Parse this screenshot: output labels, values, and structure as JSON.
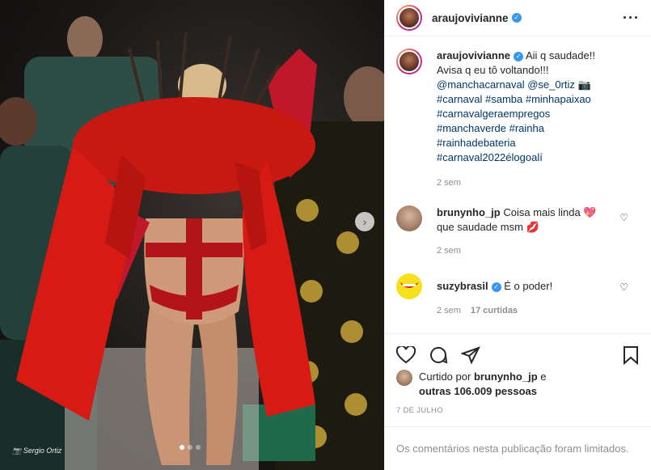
{
  "media": {
    "photo_description_icon": "carnival-photo",
    "credit": "Sergio Ortiz",
    "carousel_dots": 3,
    "carousel_active": 0
  },
  "header": {
    "username": "araujovivianne",
    "verified_icon": "verified-badge-icon",
    "more_icon": "more-options-icon"
  },
  "caption": {
    "username": "araujovivianne",
    "text_1": "Aii q saudade!! Avisa q eu tô voltando!!!",
    "mention_1": "@manchacarnaval",
    "mention_2": "@se_0rtiz",
    "camera_emoji": "📷",
    "hashtags_line_1": "#carnaval #samba #minhapaixao",
    "hashtags_line_2": "#carnavalgeraempregos",
    "hashtags_line_3": "#manchaverde #rainha",
    "hashtags_line_4": "#rainhadebateria",
    "hashtags_line_5": "#carnaval2022élogoalí",
    "time": "2 sem"
  },
  "comments": [
    {
      "username": "brunynho_jp",
      "text_a": "Coisa mais linda",
      "emoji_a": "💖",
      "text_b": "que saudade msm",
      "emoji_b": "💋",
      "time": "2 sem"
    },
    {
      "username": "suzybrasil",
      "text": "É o poder!",
      "time": "2 sem",
      "likes": "17 curtidas"
    }
  ],
  "likes": {
    "prefix": "Curtido por",
    "user": "brunynho_jp",
    "conj": "e",
    "others": "outras 106.009 pessoas"
  },
  "date": "7 DE JULHO",
  "footer": "Os comentários nesta publicação foram limitados.",
  "colors": {
    "verified": "#3897f0",
    "link": "#00376b",
    "muted": "#8e8e8e",
    "costume_red": "#d81a14"
  }
}
